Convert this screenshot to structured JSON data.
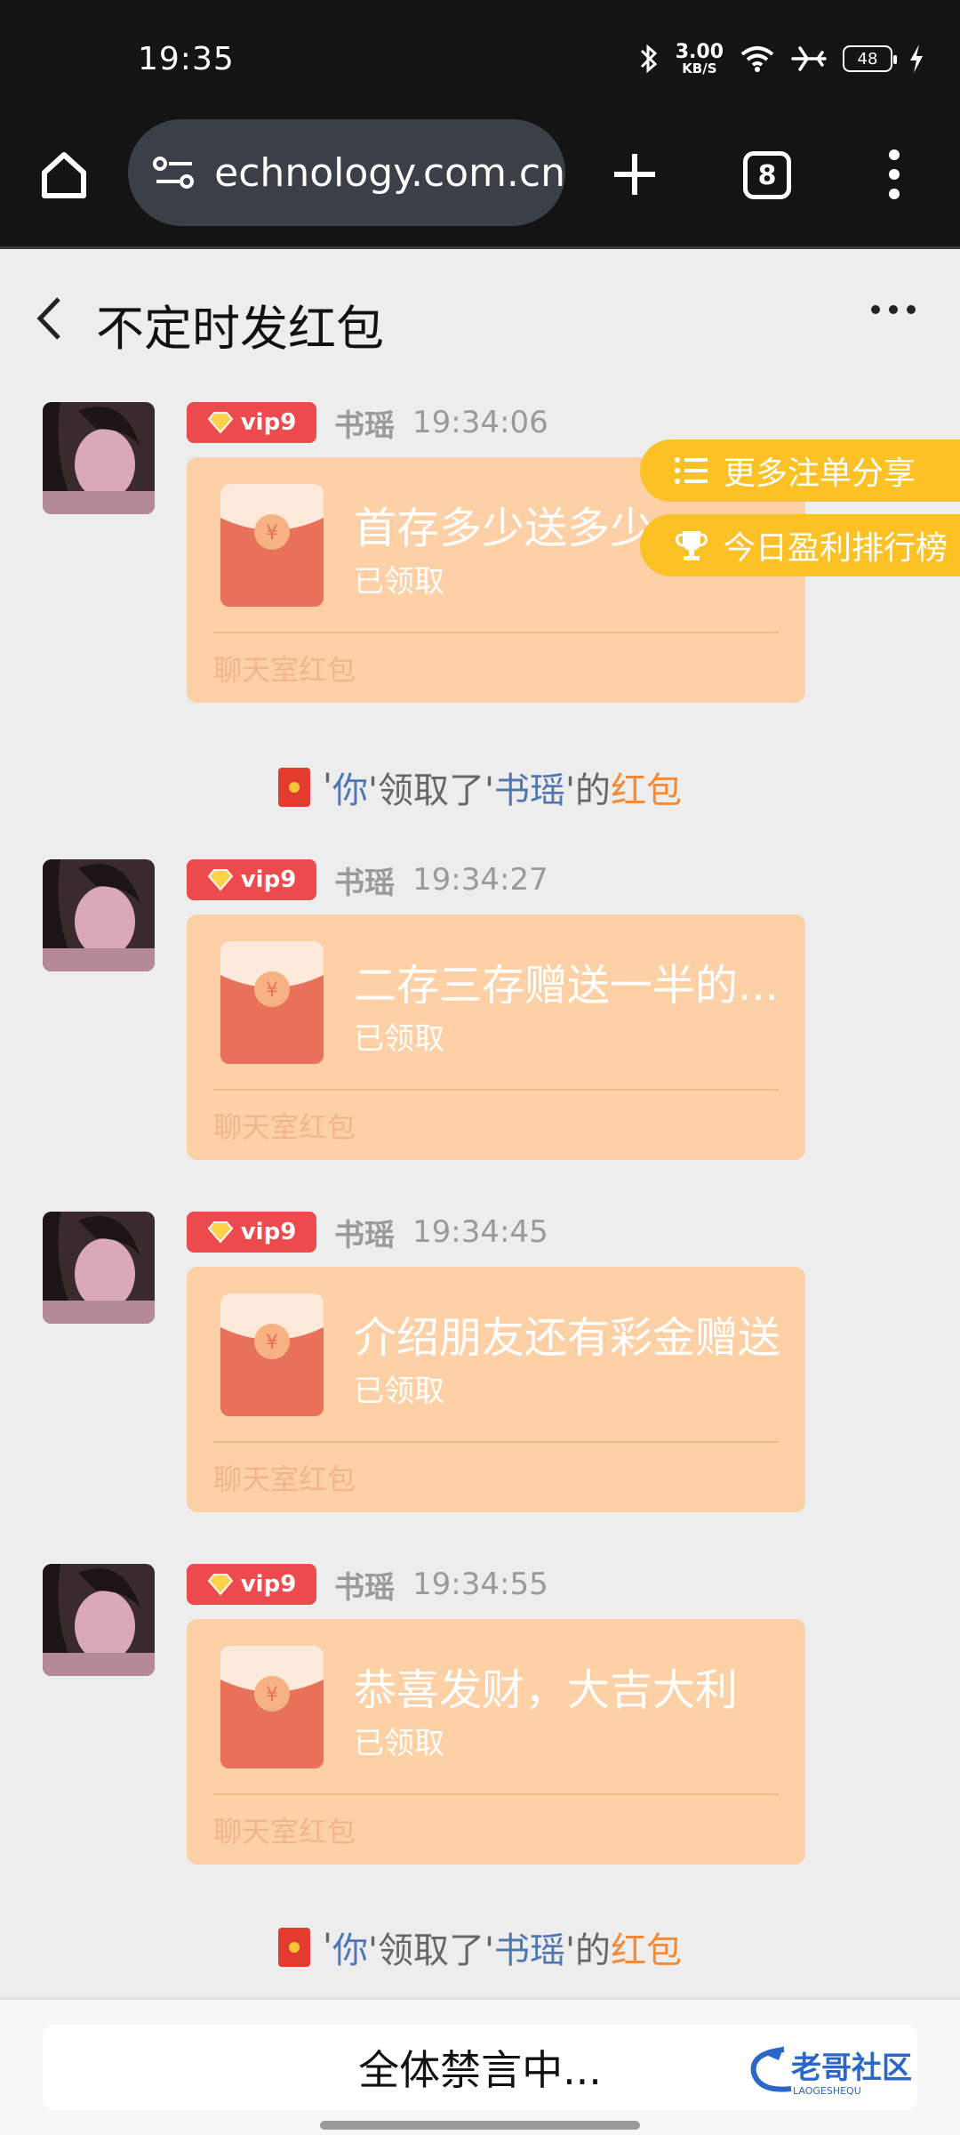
{
  "status_bar": {
    "time": "19:35",
    "net_speed_value": "3.00",
    "net_speed_unit": "KB/S",
    "battery": "48",
    "icons": [
      "bluetooth-icon",
      "wifi-icon",
      "airplane-icon",
      "battery-icon",
      "charging-icon"
    ]
  },
  "browser": {
    "url": "echnology.com.cn",
    "tab_count": "8"
  },
  "header": {
    "title": "不定时发红包"
  },
  "floating": {
    "more_bets": "更多注单分享",
    "ranking": "今日盈利排行榜"
  },
  "messages": [
    {
      "vip": "vip9",
      "sender": "书瑶",
      "time": "19:34:06",
      "packet_title": "首存多少送多少",
      "packet_status": "已领取",
      "packet_label": "聊天室红包"
    },
    {
      "vip": "vip9",
      "sender": "书瑶",
      "time": "19:34:27",
      "packet_title": "二存三存赠送一半的...",
      "packet_status": "已领取",
      "packet_label": "聊天室红包"
    },
    {
      "vip": "vip9",
      "sender": "书瑶",
      "time": "19:34:45",
      "packet_title": "介绍朋友还有彩金赠送",
      "packet_status": "已领取",
      "packet_label": "聊天室红包"
    },
    {
      "vip": "vip9",
      "sender": "书瑶",
      "time": "19:34:55",
      "packet_title": "恭喜发财，大吉大利",
      "packet_status": "已领取",
      "packet_label": "聊天室红包"
    }
  ],
  "notice": {
    "q1": "'",
    "you": "你",
    "q2": "'领取了'",
    "name": "书瑶",
    "q3": "'的",
    "hb": "红包"
  },
  "bottom": {
    "mute_text": "全体禁言中...",
    "watermark_text": "老哥社区",
    "watermark_sub": "LAOGESHEQU"
  },
  "colors": {
    "status_bg": "#141414",
    "url_pill": "#3b3f47",
    "packet_bg": "#fdd0a6",
    "packet_envelope": "#e8715a",
    "vip_badge": "#ed4a4d",
    "float_button": "#fbc125",
    "link_blue": "#4f76b0",
    "hb_orange": "#f28a36"
  }
}
